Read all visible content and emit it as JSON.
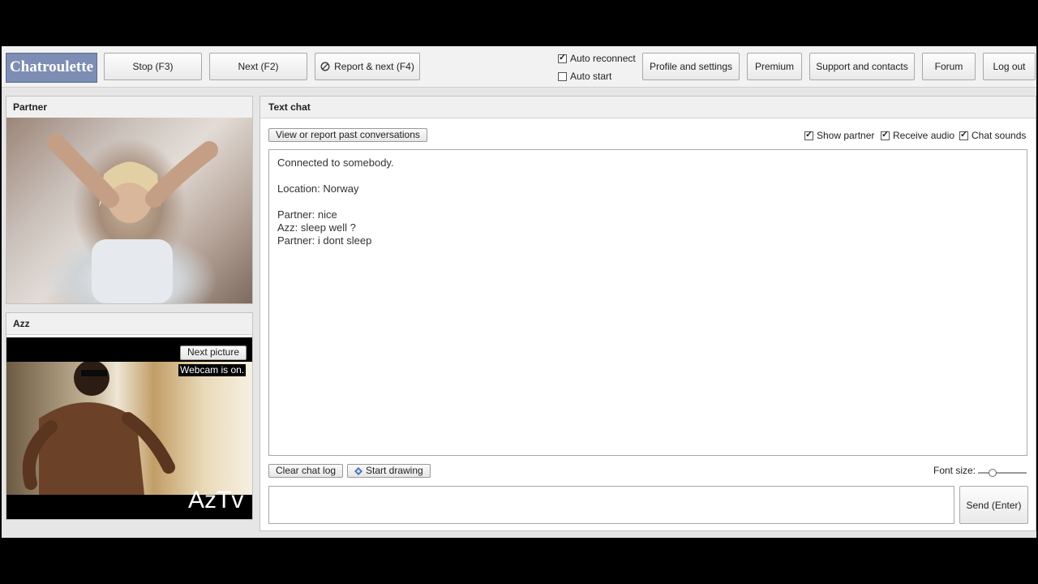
{
  "header": {
    "logo": "Chatroulette",
    "stop_label": "Stop (F3)",
    "next_label": "Next (F2)",
    "report_label": "Report & next (F4)",
    "auto_reconnect": {
      "label": "Auto reconnect",
      "checked": true
    },
    "auto_start": {
      "label": "Auto start",
      "checked": false
    },
    "profile_label": "Profile and settings",
    "premium_label": "Premium",
    "support_label": "Support and contacts",
    "forum_label": "Forum",
    "logout_label": "Log out"
  },
  "partner_panel": {
    "title": "Partner"
  },
  "self_panel": {
    "title": "Azz",
    "next_picture_label": "Next picture",
    "webcam_status": "Webcam is on.",
    "watermark": "AzTv"
  },
  "chat": {
    "title": "Text chat",
    "past_conversations_label": "View or report past conversations",
    "show_partner": {
      "label": "Show partner",
      "checked": true
    },
    "receive_audio": {
      "label": "Receive audio",
      "checked": true
    },
    "chat_sounds": {
      "label": "Chat sounds",
      "checked": true
    },
    "messages": [
      "Connected to somebody.",
      "",
      "Location: Norway",
      "",
      "Partner: nice",
      "Azz: sleep well ?",
      "Partner: i dont sleep"
    ],
    "clear_label": "Clear chat log",
    "drawing_label": "Start drawing",
    "font_size_label": "Font size:",
    "font_size_level": 0.25,
    "message_value": "",
    "send_label": "Send (Enter)"
  },
  "icons": {
    "report": "no-entry-icon",
    "drawing": "pencil-diamond-icon",
    "webcam_cursor": "cursor-icon"
  }
}
